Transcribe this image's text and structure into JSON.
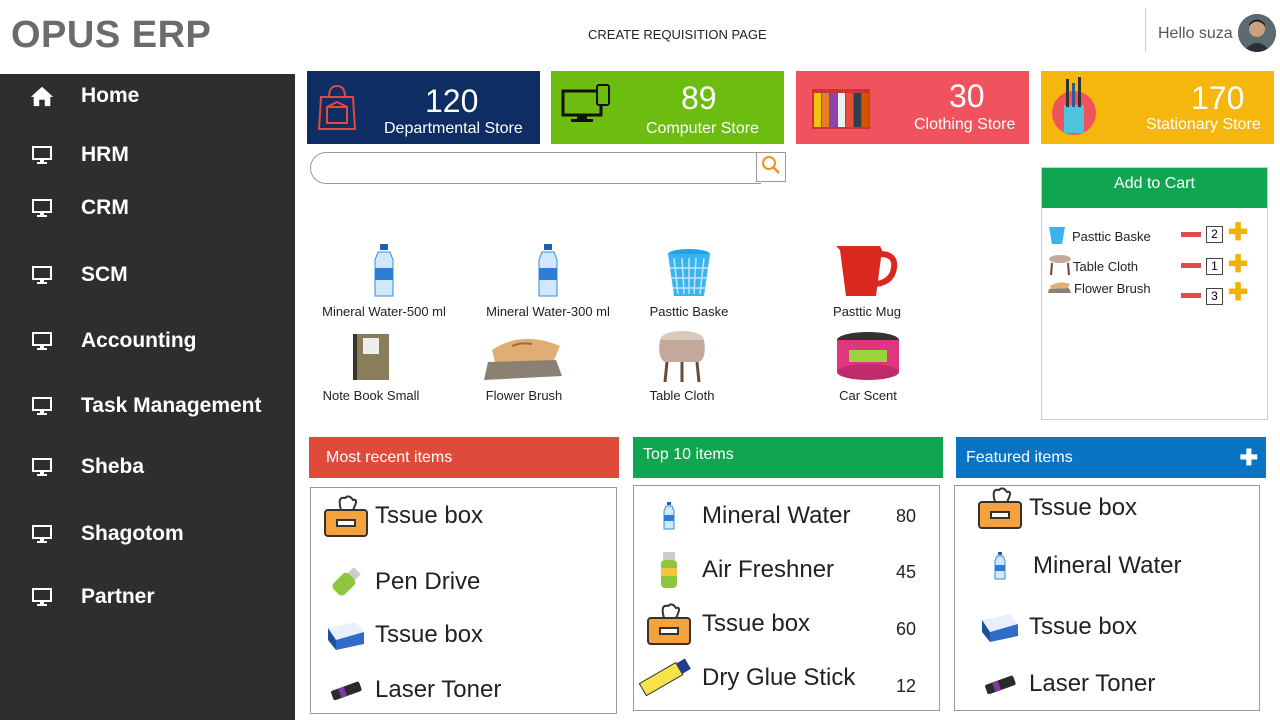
{
  "header": {
    "brand": "OPUS ERP",
    "page_title": "CREATE REQUISITION PAGE",
    "greeting": "Hello suza"
  },
  "sidebar": {
    "items": [
      {
        "label": "Home",
        "icon": "home-icon"
      },
      {
        "label": "HRM",
        "icon": "monitor-icon"
      },
      {
        "label": "CRM",
        "icon": "monitor-icon"
      },
      {
        "label": "SCM",
        "icon": "monitor-icon"
      },
      {
        "label": "Accounting",
        "icon": "monitor-icon"
      },
      {
        "label": "Task Management",
        "icon": "monitor-icon"
      },
      {
        "label": "Sheba",
        "icon": "monitor-icon"
      },
      {
        "label": "Shagotom",
        "icon": "monitor-icon"
      },
      {
        "label": "Partner",
        "icon": "monitor-icon"
      }
    ]
  },
  "stores": [
    {
      "count": "120",
      "label": "Departmental Store",
      "color": "#0e2d63",
      "icon": "shopping-bag-store-icon"
    },
    {
      "count": "89",
      "label": "Computer Store",
      "color": "#6cbd0f",
      "icon": "computer-devices-icon"
    },
    {
      "count": "30",
      "label": "Clothing Store",
      "color": "#f0535e",
      "icon": "clothes-rack-icon"
    },
    {
      "count": "170",
      "label": "Stationary Store",
      "color": "#f5b70e",
      "icon": "pen-cup-icon"
    }
  ],
  "search": {
    "placeholder": ""
  },
  "products": [
    {
      "name": "Mineral Water-500 ml",
      "icon": "water-bottle-icon"
    },
    {
      "name": "Mineral Water-300 ml",
      "icon": "water-bottle-icon"
    },
    {
      "name": "Pasttic Baske",
      "icon": "plastic-basket-icon"
    },
    {
      "name": "Pasttic Mug",
      "icon": "plastic-mug-icon"
    },
    {
      "name": "Note Book Small",
      "icon": "notebook-icon"
    },
    {
      "name": "Flower Brush",
      "icon": "brush-icon"
    },
    {
      "name": "Table Cloth",
      "icon": "table-cloth-icon"
    },
    {
      "name": "Car Scent",
      "icon": "car-scent-icon"
    }
  ],
  "cart": {
    "title": "Add to Cart",
    "items": [
      {
        "name": "Pasttic Baske",
        "qty": "2"
      },
      {
        "name": "Table Cloth",
        "qty": "1"
      },
      {
        "name": "Flower Brush",
        "qty": "3"
      }
    ]
  },
  "recent": {
    "title": "Most recent items",
    "color": "#e04a3a",
    "items": [
      {
        "name": "Tssue box",
        "icon": "tissue-box-icon"
      },
      {
        "name": "Pen Drive",
        "icon": "pen-drive-icon"
      },
      {
        "name": "Tssue box",
        "icon": "tissue-box-blue-icon"
      },
      {
        "name": "Laser Toner",
        "icon": "laser-toner-icon"
      }
    ]
  },
  "top10": {
    "title": "Top 10 items",
    "color": "#10a651",
    "items": [
      {
        "name": "Mineral Water",
        "value": "80",
        "icon": "water-bottle-icon"
      },
      {
        "name": "Air Freshner",
        "value": "45",
        "icon": "air-freshner-icon"
      },
      {
        "name": "Tssue box",
        "value": "60",
        "icon": "tissue-box-icon"
      },
      {
        "name": "Dry Glue Stick",
        "value": "12",
        "icon": "glue-stick-icon"
      }
    ]
  },
  "featured": {
    "title": "Featured items",
    "color": "#0a74c4",
    "items": [
      {
        "name": "Tssue box",
        "icon": "tissue-box-icon"
      },
      {
        "name": "Mineral Water",
        "icon": "water-bottle-icon"
      },
      {
        "name": "Tssue box",
        "icon": "tissue-box-blue-icon"
      },
      {
        "name": "Laser Toner",
        "icon": "laser-toner-icon"
      }
    ]
  }
}
